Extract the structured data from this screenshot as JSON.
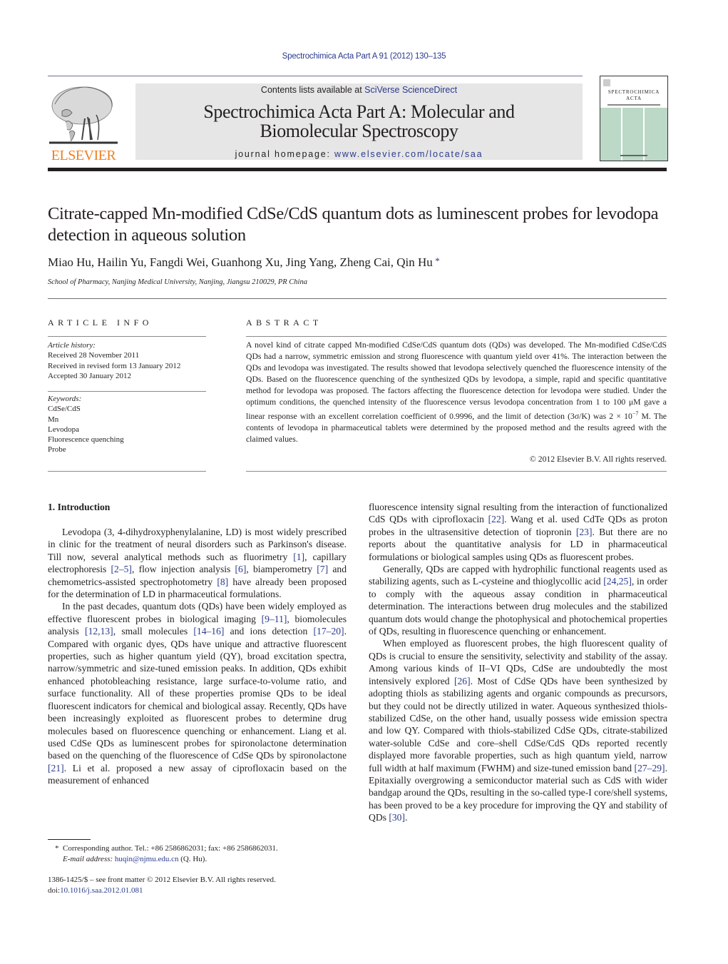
{
  "running_head": "Spectrochimica Acta Part A 91 (2012) 130–135",
  "header": {
    "publisher_logo_text": "ELSEVIER",
    "contents_prefix": "Contents lists available at ",
    "contents_link": "SciVerse ScienceDirect",
    "journal_title_line1": "Spectrochimica Acta Part A: Molecular and",
    "journal_title_line2": "Biomolecular Spectroscopy",
    "homepage_prefix": "journal homepage: ",
    "homepage_link": "www.elsevier.com/locate/saa",
    "cover_title_line1": "SPECTROCHIMICA",
    "cover_title_line2": "ACTA"
  },
  "article": {
    "title": "Citrate-capped Mn-modified CdSe/CdS quantum dots as luminescent probes for levodopa detection in aqueous solution",
    "authors": "Miao Hu, Hailin Yu, Fangdi Wei, Guanhong Xu, Jing Yang, Zheng Cai, Qin Hu",
    "corresponding_mark": "*",
    "affiliation": "School of Pharmacy, Nanjing Medical University, Nanjing, Jiangsu 210029, PR China"
  },
  "article_info": {
    "heading": "ARTICLE INFO",
    "history_label": "Article history:",
    "history": [
      "Received 28 November 2011",
      "Received in revised form 13 January 2012",
      "Accepted 30 January 2012"
    ],
    "keywords_label": "Keywords:",
    "keywords": [
      "CdSe/CdS",
      "Mn",
      "Levodopa",
      "Fluorescence quenching",
      "Probe"
    ]
  },
  "abstract": {
    "heading": "ABSTRACT",
    "text_part1": "A novel kind of citrate capped Mn-modified CdSe/CdS quantum dots (QDs) was developed. The Mn-modified CdSe/CdS QDs had a narrow, symmetric emission and strong fluorescence with quantum yield over 41%. The interaction between the QDs and levodopa was investigated. The results showed that levodopa selectively quenched the fluorescence intensity of the QDs. Based on the fluorescence quenching of the synthesized QDs by levodopa, a simple, rapid and specific quantitative method for levodopa was proposed. The factors affecting the fluorescence detection for levodopa were studied. Under the optimum conditions, the quenched intensity of the fluorescence versus levodopa concentration from 1 to 100 μM gave a linear response with an excellent correlation coefficient of 0.9996, and the limit of detection (3σ/K) was 2 × 10",
    "text_sup": "−7",
    "text_part2": " M. The contents of levodopa in pharmaceutical tablets were determined by the proposed method and the results agreed with the claimed values.",
    "copyright": "© 2012 Elsevier B.V. All rights reserved."
  },
  "introduction": {
    "heading": "1.  Introduction",
    "p1": [
      {
        "t": "Levodopa (3, 4-dihydroxyphenylalanine, LD) is most widely prescribed in clinic for the treatment of neural disorders such as Parkinson's disease. Till now, several analytical methods such as fluorimetry "
      },
      {
        "ref": "[1]"
      },
      {
        "t": ", capillary electrophoresis "
      },
      {
        "ref": "[2–5]"
      },
      {
        "t": ", flow injection analysis "
      },
      {
        "ref": "[6]"
      },
      {
        "t": ", biamperometry "
      },
      {
        "ref": "[7]"
      },
      {
        "t": " and chemometrics-assisted spectrophotometry "
      },
      {
        "ref": "[8]"
      },
      {
        "t": " have already been proposed for the determination of LD in pharmaceutical formulations."
      }
    ],
    "p2": [
      {
        "t": "In the past decades, quantum dots (QDs) have been widely employed as effective fluorescent probes in biological imaging "
      },
      {
        "ref": "[9–11]"
      },
      {
        "t": ", biomolecules analysis "
      },
      {
        "ref": "[12,13]"
      },
      {
        "t": ", small molecules "
      },
      {
        "ref": "[14–16]"
      },
      {
        "t": " and ions detection "
      },
      {
        "ref": "[17–20]"
      },
      {
        "t": ". Compared with organic dyes, QDs have unique and attractive fluorescent properties, such as higher quantum yield (QY), broad excitation spectra, narrow/symmetric and size-tuned emission peaks. In addition, QDs exhibit enhanced photobleaching resistance, large surface-to-volume ratio, and surface functionality. All of these properties promise QDs to be ideal fluorescent indicators for chemical and biological assay. Recently, QDs have been increasingly exploited as fluorescent probes to determine drug molecules based on fluorescence quenching or enhancement. Liang et al. used CdSe QDs as luminescent probes for spironolactone determination based on the quenching of the fluorescence of CdSe QDs by spironolactone "
      },
      {
        "ref": "[21]"
      },
      {
        "t": ". Li et al. proposed a new assay of ciprofloxacin based on the measurement of enhanced"
      }
    ],
    "p3": [
      {
        "t": "fluorescence intensity signal resulting from the interaction of functionalized CdS QDs with ciprofloxacin "
      },
      {
        "ref": "[22]"
      },
      {
        "t": ". Wang et al. used CdTe QDs as proton probes in the ultrasensitive detection of tiopronin "
      },
      {
        "ref": "[23]"
      },
      {
        "t": ". But there are no reports about the quantitative analysis for LD in pharmaceutical formulations or biological samples using QDs as fluorescent probes."
      }
    ],
    "p4": [
      {
        "t": "Generally, QDs are capped with hydrophilic functional reagents used as stabilizing agents, such as L-cysteine and thioglycollic acid "
      },
      {
        "ref": "[24,25]"
      },
      {
        "t": ", in order to comply with the aqueous assay condition in pharmaceutical determination. The interactions between drug molecules and the stabilized quantum dots would change the photophysical and photochemical properties of QDs, resulting in fluorescence quenching or enhancement."
      }
    ],
    "p5": [
      {
        "t": "When employed as fluorescent probes, the high fluorescent quality of QDs is crucial to ensure the sensitivity, selectivity and stability of the assay. Among various kinds of II–VI QDs, CdSe are undoubtedly the most intensively explored "
      },
      {
        "ref": "[26]"
      },
      {
        "t": ". Most of CdSe QDs have been synthesized by adopting thiols as stabilizing agents and organic compounds as precursors, but they could not be directly utilized in water. Aqueous synthesized thiols-stabilized CdSe, on the other hand, usually possess wide emission spectra and low QY. Compared with thiols-stabilized CdSe QDs, citrate-stabilized water-soluble CdSe and core–shell CdSe/CdS QDs reported recently displayed more favorable properties, such as high quantum yield, narrow full width at half maximum (FWHM) and size-tuned emission band "
      },
      {
        "ref": "[27–29]"
      },
      {
        "t": ". Epitaxially overgrowing a semiconductor material such as CdS with wider bandgap around the QDs, resulting in the so-called type-I core/shell systems, has been proved to be a key procedure for improving the QY and stability of QDs "
      },
      {
        "ref": "[30]"
      },
      {
        "t": "."
      }
    ]
  },
  "footnote": {
    "mark": "*",
    "corresponding": "Corresponding author. Tel.: +86 2586862031; fax: +86 2586862031.",
    "email_label": "E-mail address: ",
    "email": "huqin@njmu.edu.cn",
    "email_suffix": " (Q. Hu)."
  },
  "frontmatter": {
    "issn_line": "1386-1425/$ – see front matter © 2012 Elsevier B.V. All rights reserved.",
    "doi_prefix": "doi:",
    "doi": "10.1016/j.saa.2012.01.081"
  },
  "colors": {
    "link": "#2a3a8c",
    "elsevier_orange": "#f07f1f",
    "banner_bg": "#e6e6e6",
    "cover_green": "#bcd8c6"
  }
}
